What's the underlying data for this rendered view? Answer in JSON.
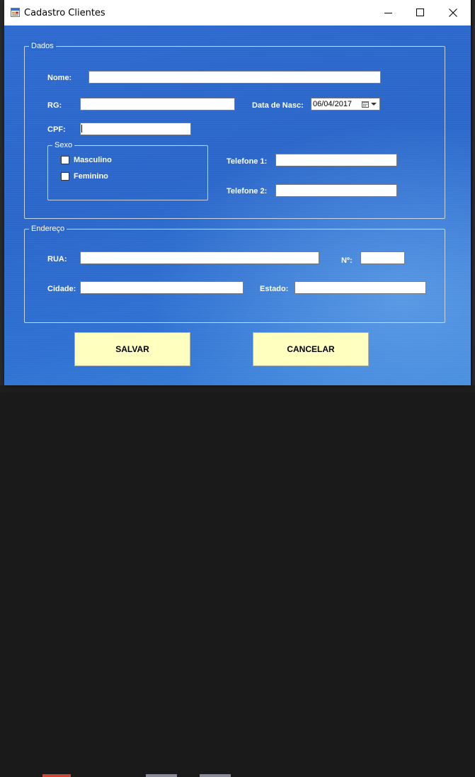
{
  "window": {
    "title": "Cadastro Clientes",
    "icons": {
      "app": "form-app-icon",
      "minimize": "minimize-icon",
      "maximize": "maximize-icon",
      "close": "close-icon"
    }
  },
  "dados": {
    "legend": "Dados",
    "nome_label": "Nome:",
    "nome_value": "",
    "rg_label": "RG:",
    "rg_value": "",
    "data_nasc_label": "Data de Nasc:",
    "data_nasc_value": "06/04/2017",
    "cpf_label": "CPF:",
    "cpf_value": "",
    "sexo": {
      "legend": "Sexo",
      "options": [
        {
          "label": "Masculino",
          "checked": false
        },
        {
          "label": "Feminino",
          "checked": false
        }
      ]
    },
    "telefone1_label": "Telefone 1:",
    "telefone1_value": "",
    "telefone2_label": "Telefone 2:",
    "telefone2_value": ""
  },
  "endereco": {
    "legend": "Endereço",
    "rua_label": "RUA:",
    "rua_value": "",
    "numero_label": "Nº:",
    "numero_value": "",
    "cidade_label": "Cidade:",
    "cidade_value": "",
    "estado_label": "Estado:",
    "estado_value": ""
  },
  "actions": {
    "salvar": "SALVAR",
    "cancelar": "CANCELAR"
  },
  "colors": {
    "form_background": "#2d69cd",
    "button_background": "#ffffc0",
    "label_text": "#ffffff"
  }
}
